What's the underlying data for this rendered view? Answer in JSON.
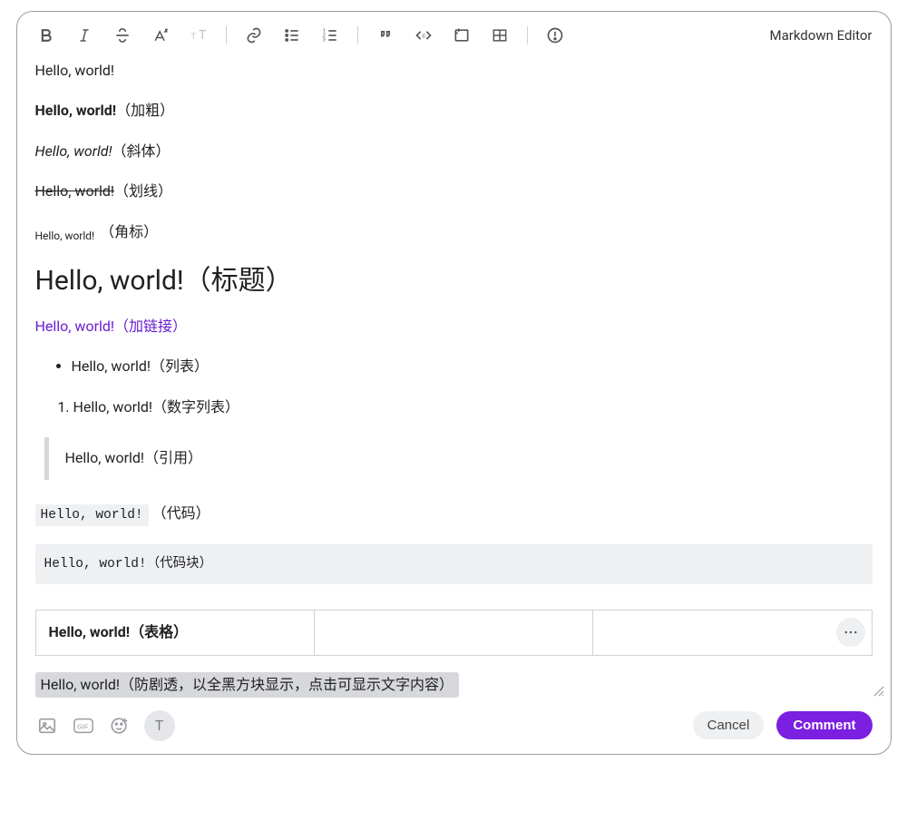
{
  "header": {
    "mode_label": "Markdown Editor"
  },
  "content": {
    "plain": "Hello, world!",
    "bold_text": "Hello, world!",
    "bold_annot": "（加粗）",
    "italic_text": "Hello, world!",
    "italic_annot": "（斜体）",
    "strike_text": "Hello, world!",
    "strike_annot": "（划线）",
    "sup_text": "Hello, world!",
    "sup_annot": "（角标）",
    "heading": "Hello, world!（标题）",
    "link": "Hello, world!（加链接）",
    "bullet_item": "Hello, world!（列表）",
    "number_item": "Hello, world!（数字列表）",
    "quote": "Hello, world!（引用）",
    "inline_code": "Hello, world!",
    "inline_code_annot": "（代码）",
    "code_block": "Hello, world!（代码块）",
    "table_header": "Hello, world!（表格）",
    "spoiler": "Hello, world!（防剧透，以全黑方块显示，点击可显示文字内容）"
  },
  "footer": {
    "avatar_initial": "T",
    "cancel_label": "Cancel",
    "comment_label": "Comment"
  }
}
